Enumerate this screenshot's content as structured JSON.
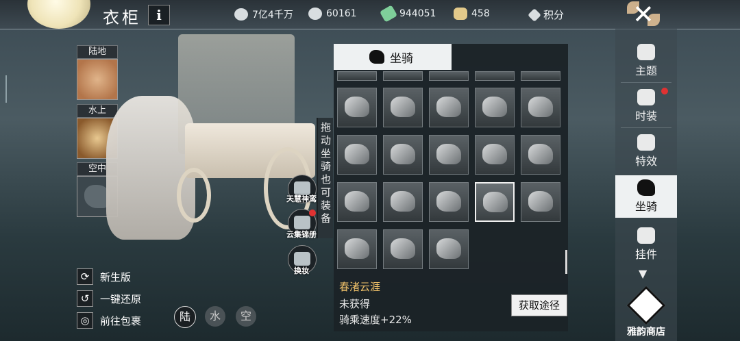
{
  "header": {
    "title": "衣柜",
    "info_label": "i",
    "currencies": [
      {
        "icon": "silver-coin-icon",
        "value": "7亿4千万"
      },
      {
        "icon": "ingot-icon",
        "value": "60161"
      },
      {
        "icon": "jade-icon",
        "value": "944051"
      },
      {
        "icon": "gold-ingot-icon",
        "value": "458"
      },
      {
        "icon": "points-icon",
        "value": "积分"
      }
    ]
  },
  "modes": {
    "land_label": "陆地",
    "water_label": "水上",
    "air_label": "空中"
  },
  "side_buttons": {
    "skin_label": "天慧神鸾",
    "gallery_label": "云集锦册",
    "change_label": "换妆",
    "drag_hint": "拖动坐骑也可装备"
  },
  "actions": {
    "new_version": "新生版",
    "reset": "一键还原",
    "bag": "前往包裹"
  },
  "terrain": {
    "land": "陆",
    "water": "水",
    "air": "空"
  },
  "mount_panel": {
    "tab_label": "坐骑",
    "selected_name": "春渚云涯",
    "status": "未获得",
    "speed": "骑乘速度+22%",
    "obtain_label": "获取途径"
  },
  "sidebar": {
    "items": [
      {
        "label": "主题",
        "icon": "mushroom-icon"
      },
      {
        "label": "时装",
        "icon": "robe-icon"
      },
      {
        "label": "特效",
        "icon": "swirl-icon"
      },
      {
        "label": "坐骑",
        "icon": "horse-icon"
      },
      {
        "label": "挂件",
        "icon": "pendant-icon"
      }
    ],
    "shop_label": "雅韵商店"
  },
  "colors": {
    "accent_gold": "#f1c26a",
    "notification_red": "#e03232"
  }
}
